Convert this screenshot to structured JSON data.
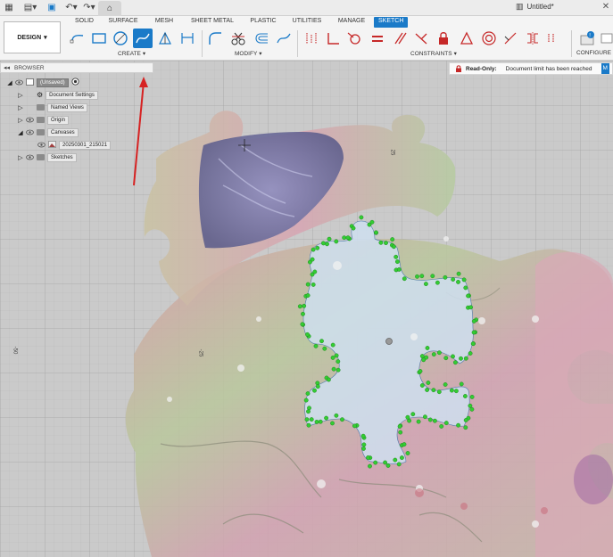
{
  "app": {
    "title": "Untitled*",
    "quick_access": [
      "grid-icon",
      "file-icon",
      "save-icon",
      "undo-icon",
      "redo-icon",
      "home-icon"
    ]
  },
  "workspace": {
    "label": "DESIGN"
  },
  "tabs": [
    {
      "label": "SOLID",
      "active": false
    },
    {
      "label": "SURFACE",
      "active": false
    },
    {
      "label": "MESH",
      "active": false
    },
    {
      "label": "SHEET METAL",
      "active": false
    },
    {
      "label": "PLASTIC",
      "active": false
    },
    {
      "label": "UTILITIES",
      "active": false
    },
    {
      "label": "MANAGE",
      "active": false
    },
    {
      "label": "SKETCH",
      "active": true
    }
  ],
  "ribbon": {
    "groups": {
      "create": "CREATE",
      "modify": "MODIFY",
      "constraints": "CONSTRAINTS",
      "configure": "CONFIGURE"
    }
  },
  "browser": {
    "title": "BROWSER",
    "items": [
      {
        "label": "(Unsaved)",
        "type": "root"
      },
      {
        "label": "Document Settings",
        "type": "settings"
      },
      {
        "label": "Named Views",
        "type": "folder"
      },
      {
        "label": "Origin",
        "type": "folder"
      },
      {
        "label": "Canvases",
        "type": "folder"
      },
      {
        "label": "20250301_215021",
        "type": "canvas"
      },
      {
        "label": "Sketches",
        "type": "folder"
      }
    ]
  },
  "banner": {
    "title": "Read-Only:",
    "message": "Document limit has been reached",
    "more": "M"
  },
  "canvas": {
    "axis_labels": [
      "25",
      "-25",
      "-50"
    ]
  },
  "colors": {
    "accent": "#1a7ac8",
    "constraint_red": "#c62828",
    "sketch_point": "#33cc33",
    "sketch_fill": "#cfe0f0"
  }
}
